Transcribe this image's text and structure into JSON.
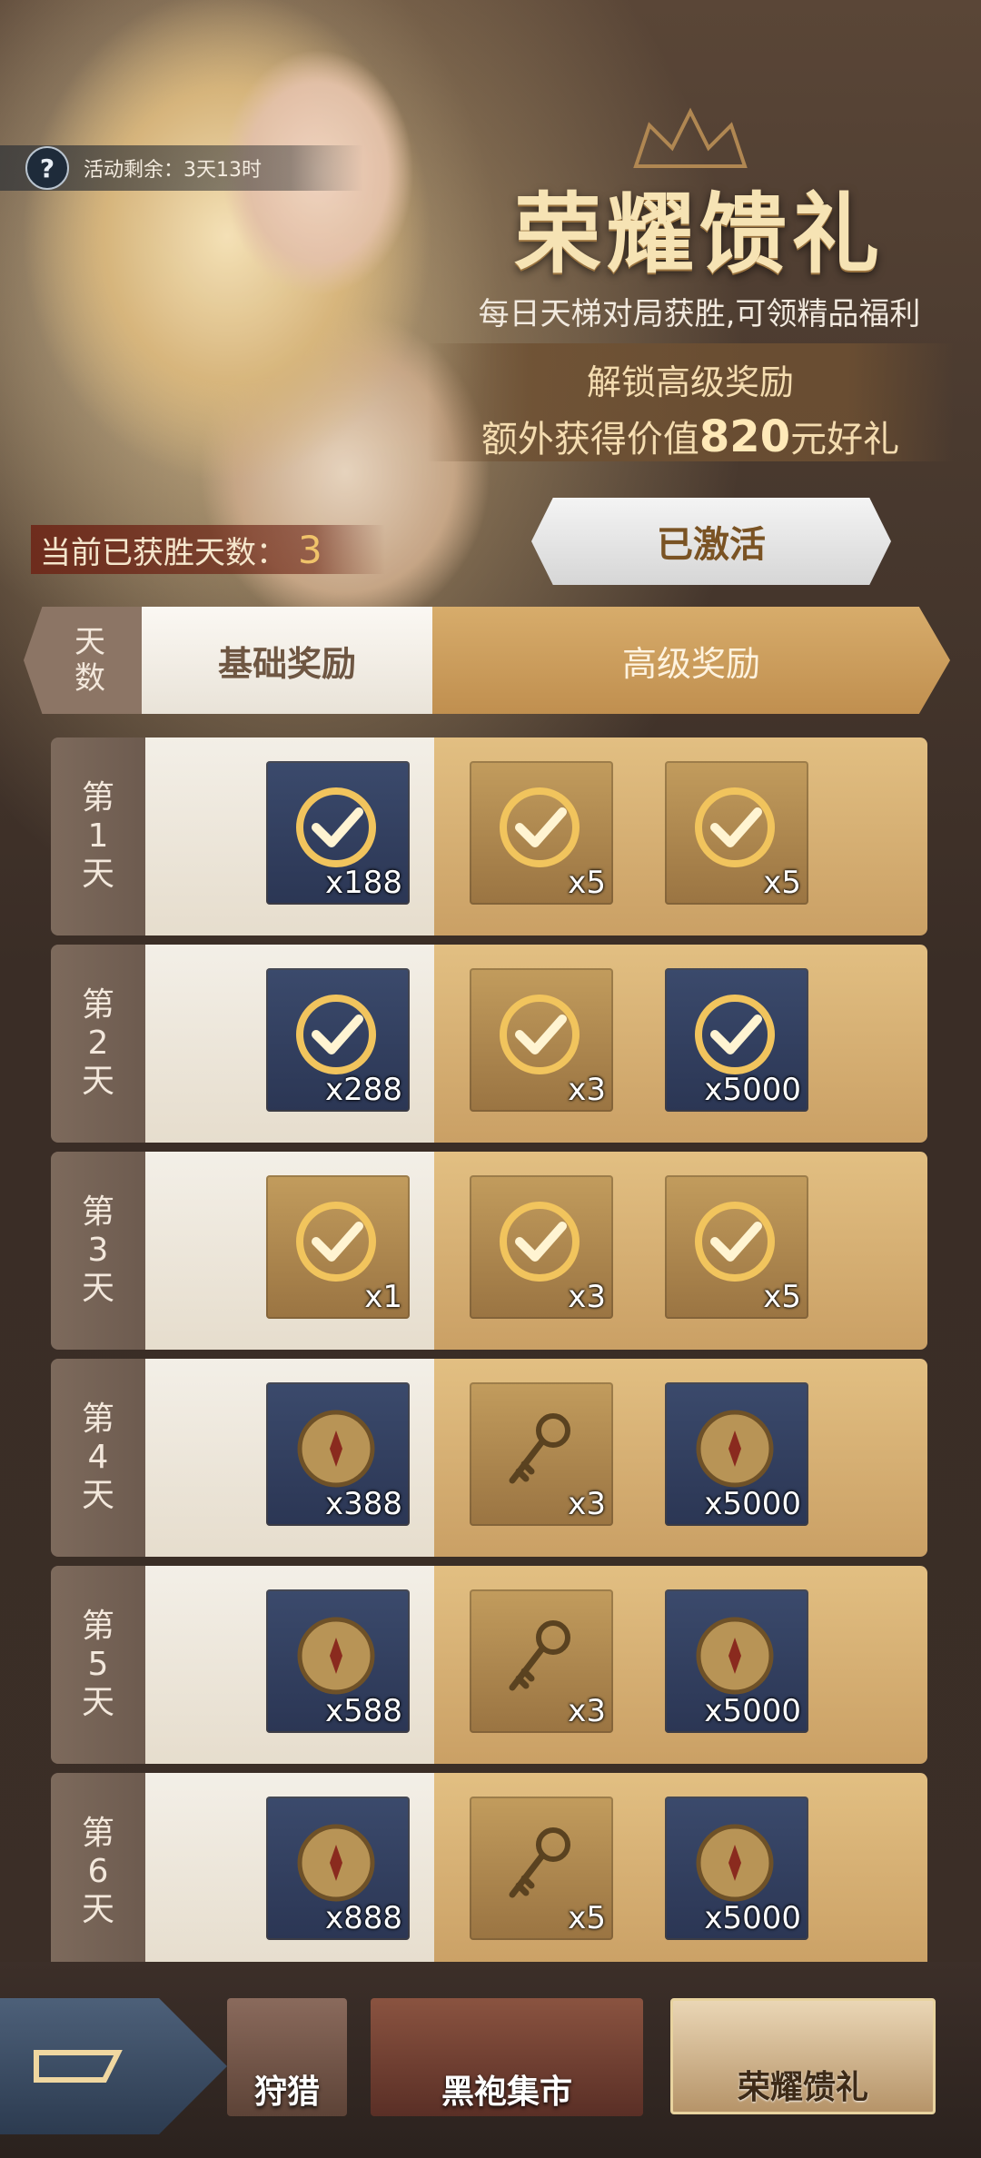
{
  "header": {
    "timer_text": "活动剩余：3天13时",
    "title": "荣耀馈礼",
    "subtitle": "每日天梯对局获胜,可领精品福利",
    "unlock_line1": "解锁高级奖励",
    "unlock_line2_prefix": "额外获得价值",
    "unlock_value": "820",
    "unlock_line2_suffix": "元好礼",
    "wins_label": "当前已获胜天数：",
    "wins_value": "3",
    "activated_label": "已激活"
  },
  "tabs": {
    "days_label_1": "天",
    "days_label_2": "数",
    "basic_label": "基础奖励",
    "advanced_label": "高级奖励"
  },
  "rows": [
    {
      "d1": "第",
      "d2": "1",
      "d3": "天",
      "basic": {
        "count": "x188",
        "bg": "blue",
        "icon": "claimed-check-icon"
      },
      "adv1": {
        "count": "x5",
        "bg": "gold",
        "icon": "claimed-check-icon"
      },
      "adv2": {
        "count": "x5",
        "bg": "gold",
        "icon": "claimed-check-icon"
      }
    },
    {
      "d1": "第",
      "d2": "2",
      "d3": "天",
      "basic": {
        "count": "x288",
        "bg": "blue",
        "icon": "claimed-check-icon"
      },
      "adv1": {
        "count": "x3",
        "bg": "gold",
        "icon": "claimed-check-icon"
      },
      "adv2": {
        "count": "x5000",
        "bg": "blue",
        "icon": "claimed-check-icon"
      }
    },
    {
      "d1": "第",
      "d2": "3",
      "d3": "天",
      "basic": {
        "count": "x1",
        "bg": "gold",
        "icon": "claimed-check-icon"
      },
      "adv1": {
        "count": "x3",
        "bg": "gold",
        "icon": "claimed-check-icon"
      },
      "adv2": {
        "count": "x5",
        "bg": "gold",
        "icon": "claimed-check-icon"
      }
    },
    {
      "d1": "第",
      "d2": "4",
      "d3": "天",
      "basic": {
        "count": "x388",
        "bg": "blue",
        "icon": "coin-icon"
      },
      "adv1": {
        "count": "x3",
        "bg": "gold",
        "icon": "key-icon"
      },
      "adv2": {
        "count": "x5000",
        "bg": "blue",
        "icon": "coin-icon"
      }
    },
    {
      "d1": "第",
      "d2": "5",
      "d3": "天",
      "basic": {
        "count": "x588",
        "bg": "blue",
        "icon": "coin-icon"
      },
      "adv1": {
        "count": "x3",
        "bg": "gold",
        "icon": "key-icon"
      },
      "adv2": {
        "count": "x5000",
        "bg": "blue",
        "icon": "coin-icon"
      }
    },
    {
      "d1": "第",
      "d2": "6",
      "d3": "天",
      "basic": {
        "count": "x888",
        "bg": "blue",
        "icon": "coin-icon"
      },
      "adv1": {
        "count": "x5",
        "bg": "gold",
        "icon": "key-icon"
      },
      "adv2": {
        "count": "x5000",
        "bg": "blue",
        "icon": "coin-icon"
      }
    }
  ],
  "bottom_nav": {
    "card1_label": "狩猎",
    "card2_label": "黑袍集市",
    "card3_label": "荣耀馈礼"
  }
}
